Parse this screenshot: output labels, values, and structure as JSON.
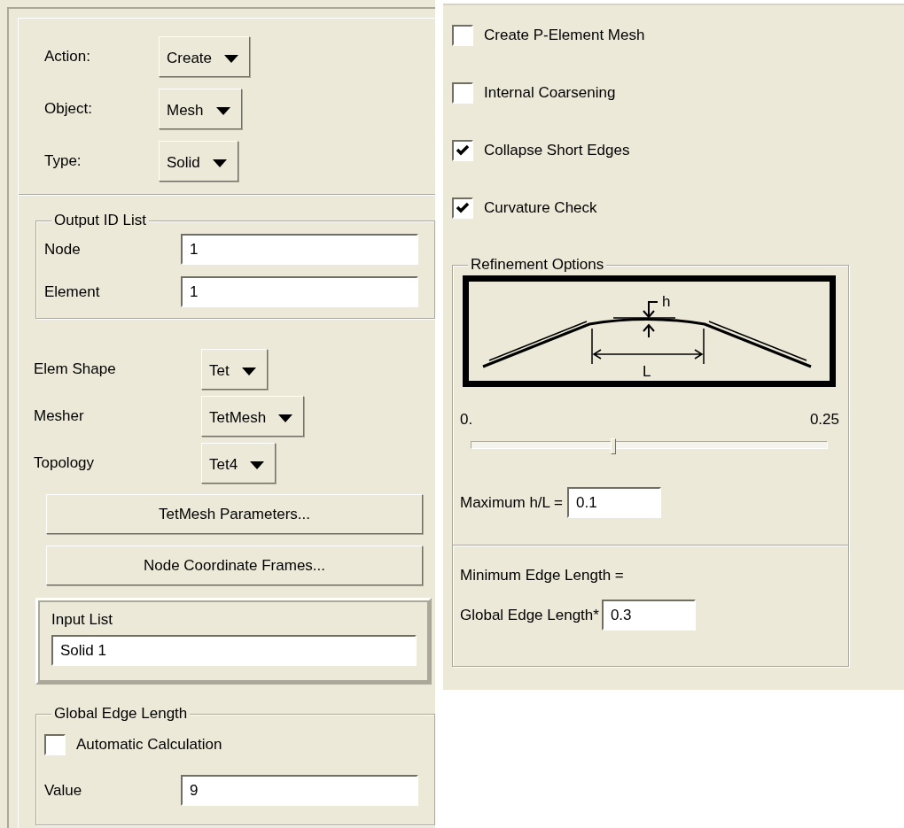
{
  "left_panel": {
    "selectors": [
      {
        "label": "Action:",
        "value": "Create"
      },
      {
        "label": "Object:",
        "value": "Mesh"
      },
      {
        "label": "Type:",
        "value": "Solid"
      }
    ],
    "output_id_list": {
      "title": "Output ID List",
      "fields": [
        {
          "label": "Node",
          "value": "1"
        },
        {
          "label": "Element",
          "value": "1"
        }
      ]
    },
    "mesh_options": [
      {
        "label": "Elem Shape",
        "value": "Tet"
      },
      {
        "label": "Mesher",
        "value": "TetMesh"
      },
      {
        "label": "Topology",
        "value": "Tet4"
      }
    ],
    "buttons": [
      "TetMesh Parameters...",
      "Node Coordinate Frames..."
    ],
    "input_list": {
      "title": "Input List",
      "value": "Solid 1"
    },
    "global_edge_length": {
      "title": "Global Edge Length",
      "checkbox": {
        "label": "Automatic Calculation",
        "checked": false
      },
      "value_field": {
        "label": "Value",
        "value": "9"
      }
    }
  },
  "right_panel": {
    "checkboxes": [
      {
        "label": "Create P-Element Mesh",
        "checked": false
      },
      {
        "label": "Internal Coarsening",
        "checked": false
      },
      {
        "label": "Collapse Short Edges",
        "checked": true
      },
      {
        "label": "Curvature Check",
        "checked": true
      }
    ],
    "refinement_options": {
      "title": "Refinement Options",
      "diagram_labels": {
        "height": "h",
        "length": "L"
      },
      "slider": {
        "min_label": "0.",
        "max_label": "0.25",
        "level": 0.4
      },
      "max_ratio": {
        "label": "Maximum h/L =",
        "value": "0.1"
      }
    },
    "edge_length": {
      "text": "Minimum Edge Length =",
      "label": "Global Edge Length*",
      "value": "0.3"
    }
  }
}
